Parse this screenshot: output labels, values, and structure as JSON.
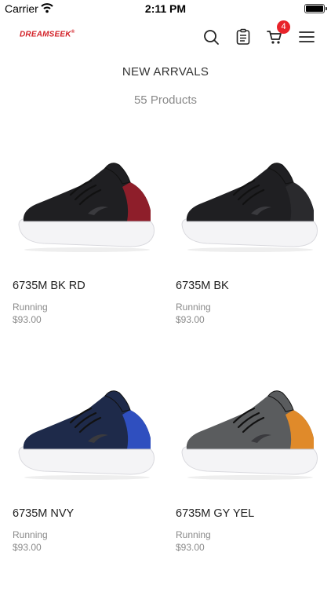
{
  "status_bar": {
    "carrier": "Carrier",
    "time": "2:11 PM"
  },
  "nav": {
    "logo": "DREAMSEEK",
    "logo_mark": "®",
    "cart_count": "4",
    "icons": [
      "search-icon",
      "orders-icon",
      "cart-icon",
      "menu-icon"
    ],
    "accent_color": "#e8232a"
  },
  "header": {
    "title": "NEW ARRVALS",
    "count": "55 Products"
  },
  "products": [
    {
      "name": "6735M BK RD",
      "category": "Running",
      "price": "$93.00",
      "body_color": "#1f1f22",
      "accent_color": "#8e1e2a"
    },
    {
      "name": "6735M BK",
      "category": "Running",
      "price": "$93.00",
      "body_color": "#1f1f22",
      "accent_color": "#2a2a2d"
    },
    {
      "name": "6735M NVY",
      "category": "Running",
      "price": "$93.00",
      "body_color": "#1e2a4a",
      "accent_color": "#2f4fbf"
    },
    {
      "name": "6735M GY YEL",
      "category": "Running",
      "price": "$93.00",
      "body_color": "#5a5c5e",
      "accent_color": "#e08a2a"
    }
  ]
}
